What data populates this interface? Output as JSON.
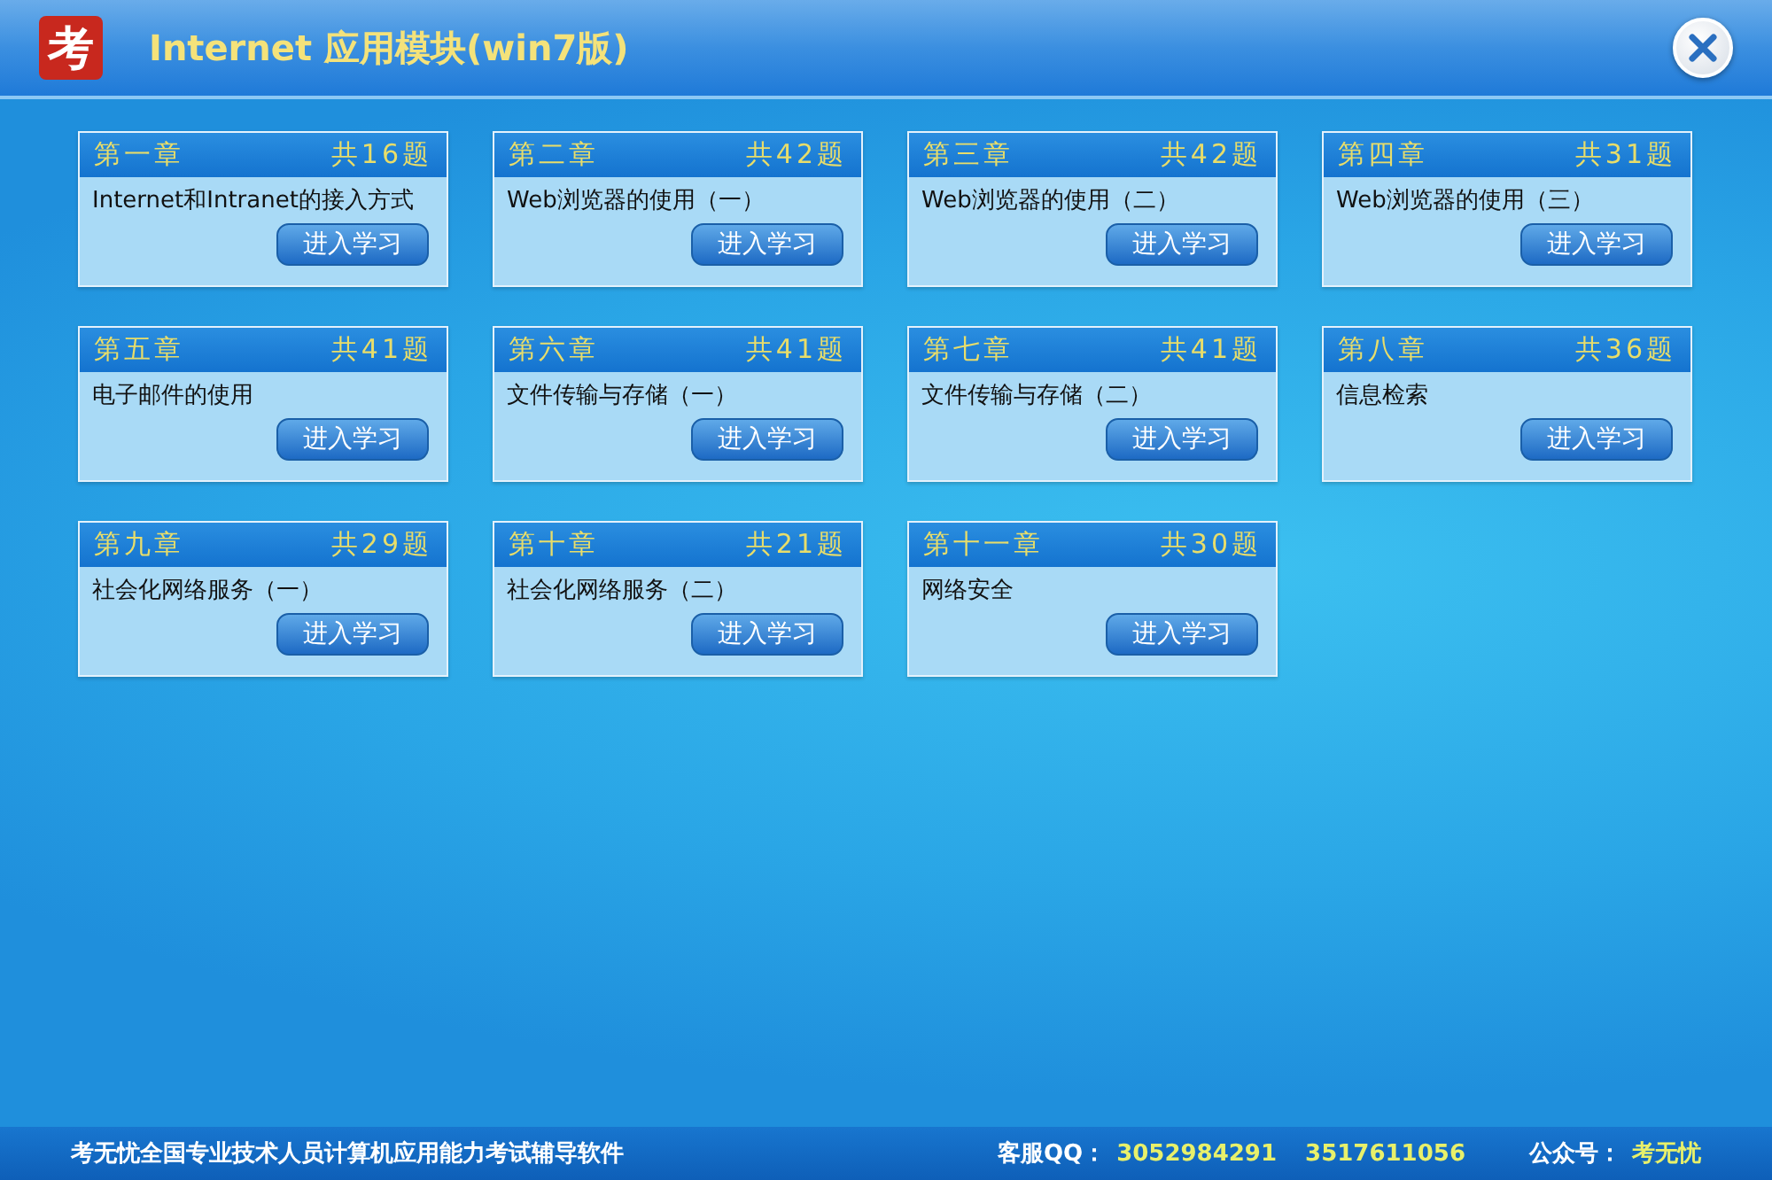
{
  "header": {
    "logo": "考",
    "title": "Internet 应用模块(win7版)"
  },
  "chapters": [
    {
      "chapter": "第一章",
      "count": "共16题",
      "topic": "Internet和Intranet的接入方式",
      "button": "进入学习"
    },
    {
      "chapter": "第二章",
      "count": "共42题",
      "topic": "Web浏览器的使用（一）",
      "button": "进入学习"
    },
    {
      "chapter": "第三章",
      "count": "共42题",
      "topic": "Web浏览器的使用（二）",
      "button": "进入学习"
    },
    {
      "chapter": "第四章",
      "count": "共31题",
      "topic": "Web浏览器的使用（三）",
      "button": "进入学习"
    },
    {
      "chapter": "第五章",
      "count": "共41题",
      "topic": "电子邮件的使用",
      "button": "进入学习"
    },
    {
      "chapter": "第六章",
      "count": "共41题",
      "topic": "文件传输与存储（一）",
      "button": "进入学习"
    },
    {
      "chapter": "第七章",
      "count": "共41题",
      "topic": "文件传输与存储（二）",
      "button": "进入学习"
    },
    {
      "chapter": "第八章",
      "count": "共36题",
      "topic": "信息检索",
      "button": "进入学习"
    },
    {
      "chapter": "第九章",
      "count": "共29题",
      "topic": "社会化网络服务（一）",
      "button": "进入学习"
    },
    {
      "chapter": "第十章",
      "count": "共21题",
      "topic": "社会化网络服务（二）",
      "button": "进入学习"
    },
    {
      "chapter": "第十一章",
      "count": "共30题",
      "topic": "网络安全",
      "button": "进入学习"
    }
  ],
  "footer": {
    "slogan": "考无忧全国专业技术人员计算机应用能力考试辅导软件",
    "service_label": "客服QQ：",
    "qq_numbers": [
      "3052984291",
      "3517611056"
    ],
    "account_label": "公众号：",
    "account": "考无忧"
  }
}
